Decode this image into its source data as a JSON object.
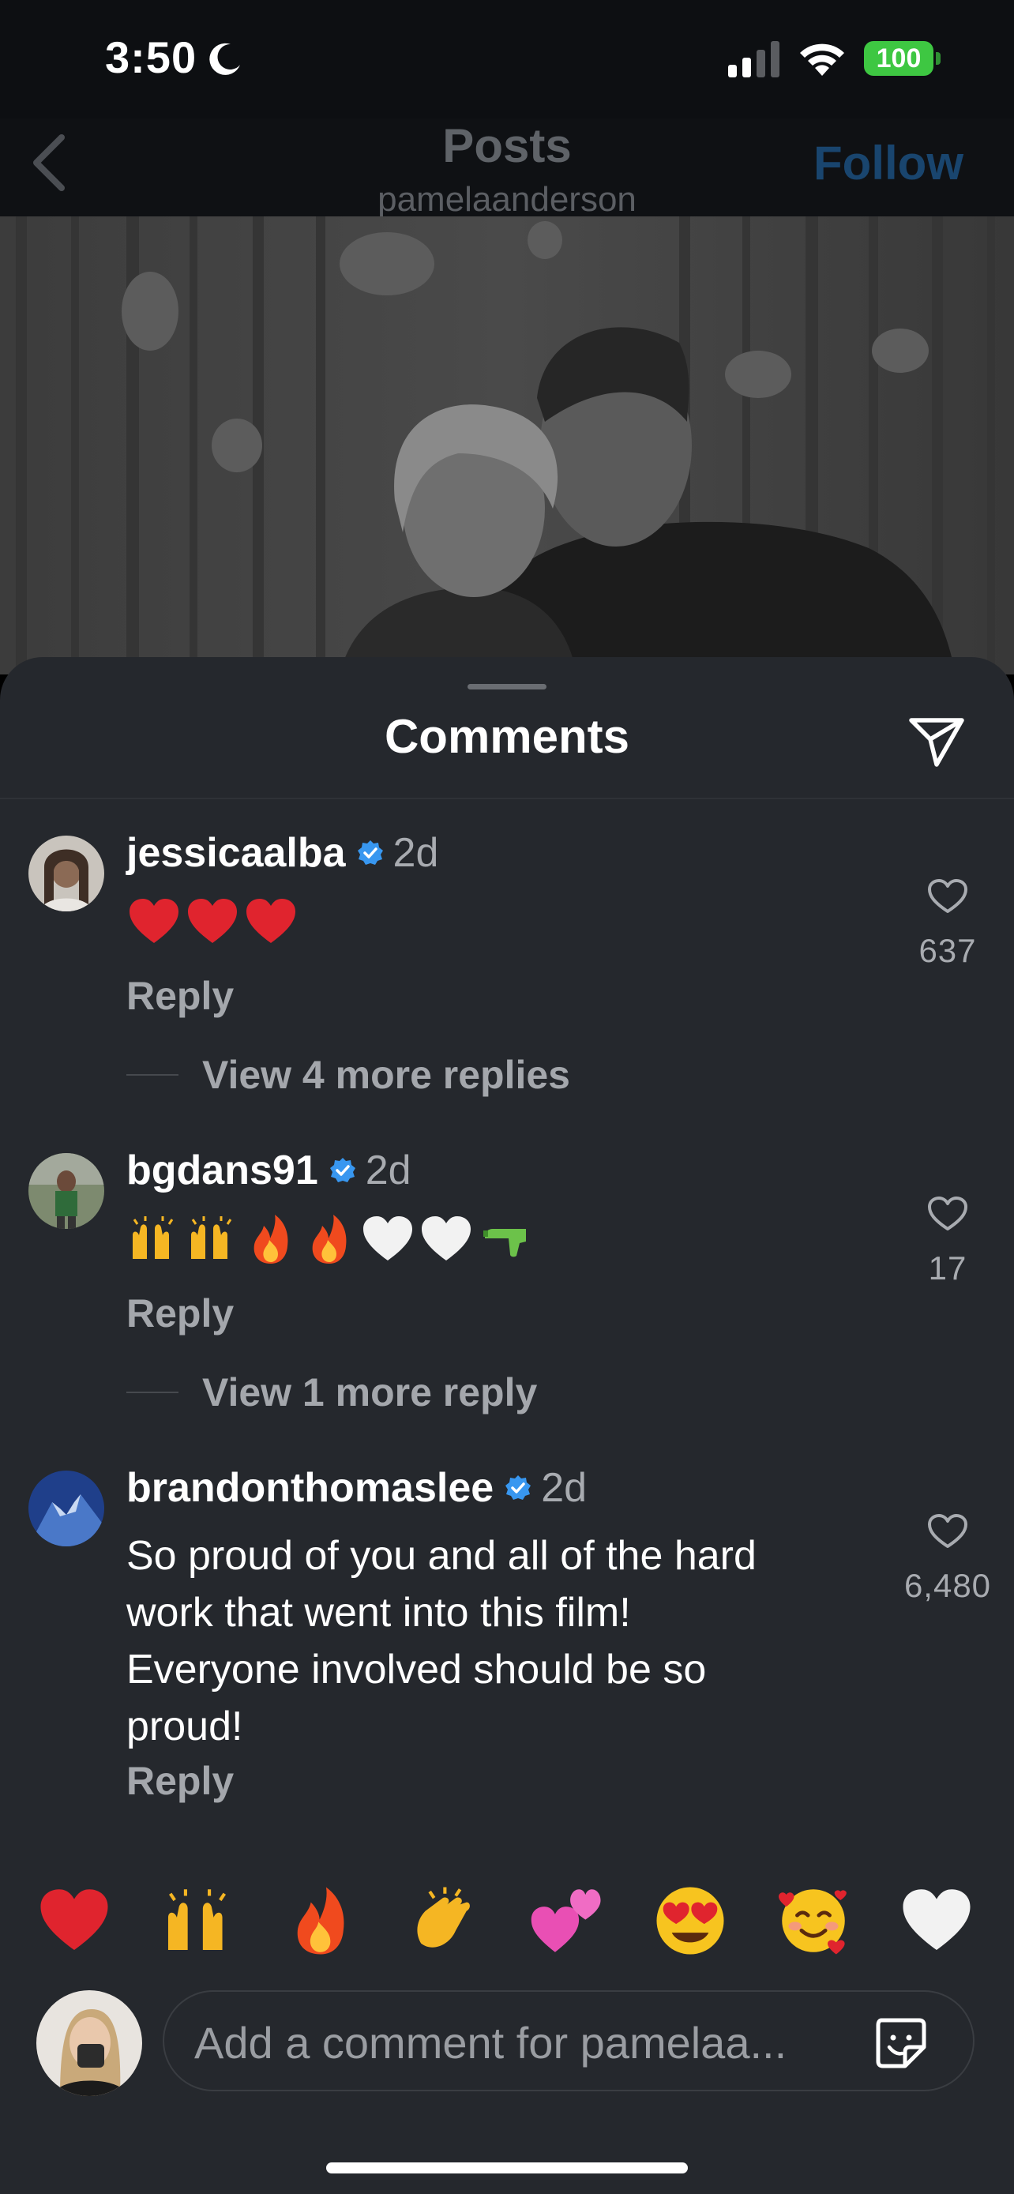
{
  "status_bar": {
    "time": "3:50",
    "battery": "100"
  },
  "header": {
    "title": "Posts",
    "subtitle": "pamelaanderson",
    "follow_label": "Follow"
  },
  "sheet": {
    "title": "Comments"
  },
  "comments": [
    {
      "username": "jessicaalba",
      "time": "2d",
      "text": "❤️❤️❤️",
      "likes": "637",
      "reply_label": "Reply",
      "view_replies": "View 4 more replies"
    },
    {
      "username": "bgdans91",
      "time": "2d",
      "text": "🙌🙌🔥🔥🤍🤍🔫",
      "likes": "17",
      "reply_label": "Reply",
      "view_replies": "View 1 more reply"
    },
    {
      "username": "brandonthomaslee",
      "time": "2d",
      "text_lines": [
        "So proud of you and all of the hard",
        "work that went into this film!",
        "Everyone involved should be so",
        "proud!"
      ],
      "likes": "6,480",
      "reply_label": "Reply"
    }
  ],
  "reactions": [
    "❤️",
    "🙌",
    "🔥",
    "👏",
    "💕",
    "😍",
    "🥰",
    "🤍"
  ],
  "composer": {
    "placeholder": "Add a comment for pamelaa..."
  },
  "colors": {
    "sheet_bg": "#25282d",
    "verified": "#3897f0",
    "follow_dimmed": "#19456e",
    "battery": "#3ec742"
  }
}
